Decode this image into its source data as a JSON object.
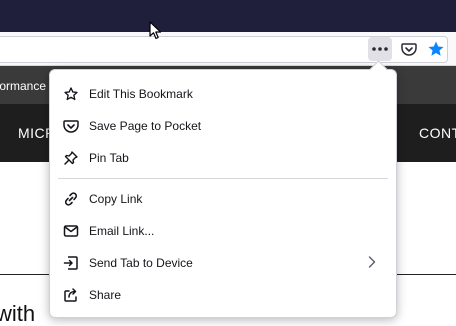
{
  "browser": {
    "url_text": "",
    "page_actions_icon": "more-horizontal-icon",
    "pocket_icon": "pocket-icon",
    "bookmark_icon": "star-filled-icon"
  },
  "page": {
    "topbar_text": "formance",
    "nav_left": "MICR",
    "nav_right": "CONT",
    "body_text": "with"
  },
  "menu": {
    "items": [
      {
        "label": "Edit This Bookmark",
        "icon": "star-outline-icon"
      },
      {
        "label": "Save Page to Pocket",
        "icon": "pocket-icon"
      },
      {
        "label": "Pin Tab",
        "icon": "pin-icon"
      },
      {
        "label": "Copy Link",
        "icon": "link-icon"
      },
      {
        "label": "Email Link...",
        "icon": "email-icon"
      },
      {
        "label": "Send Tab to Device",
        "icon": "send-tab-icon",
        "has_submenu": true
      },
      {
        "label": "Share",
        "icon": "share-icon"
      }
    ]
  },
  "colors": {
    "titlebar": "#1f1f3b",
    "accent_blue": "#0a84ff",
    "menu_text": "#15141a"
  }
}
